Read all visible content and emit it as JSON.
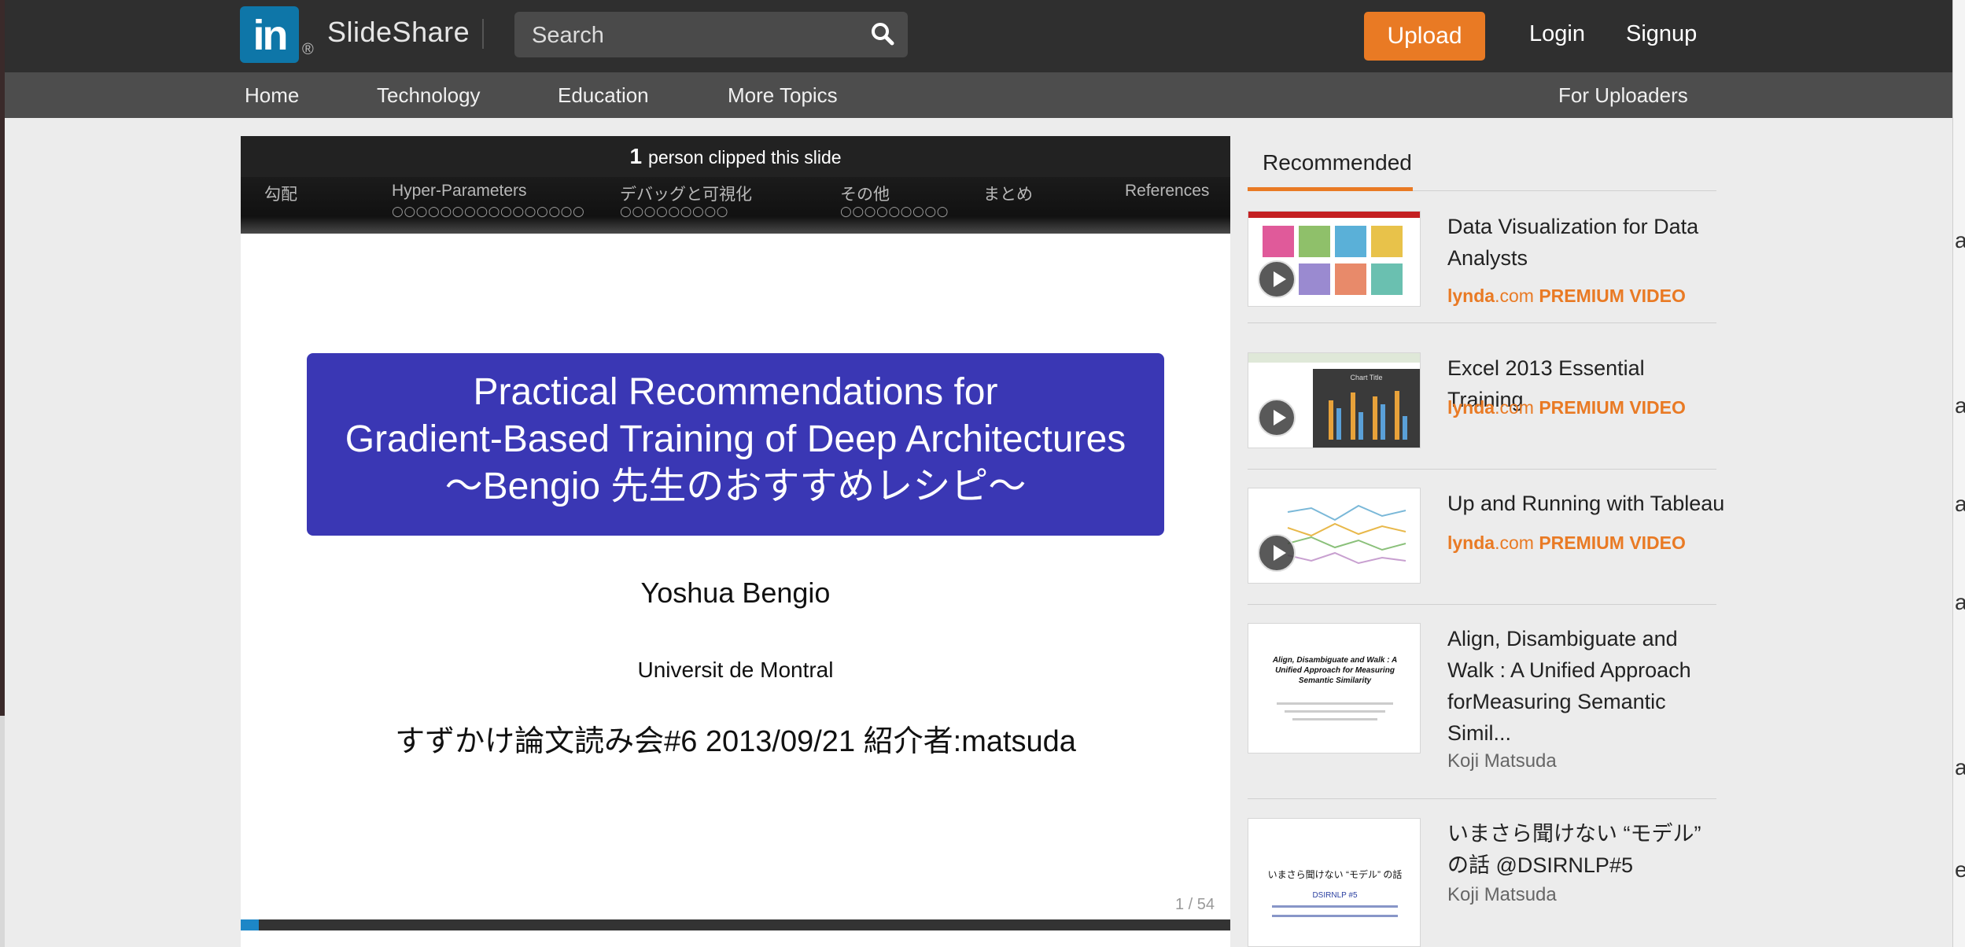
{
  "header": {
    "logo_text": "in",
    "logo_reg": "®",
    "brand": "SlideShare",
    "search_placeholder": "Search",
    "upload_label": "Upload",
    "login_label": "Login",
    "signup_label": "Signup",
    "accent": "#e97a24"
  },
  "nav": {
    "home": "Home",
    "technology": "Technology",
    "education": "Education",
    "more_topics": "More Topics",
    "for_uploaders": "For Uploaders"
  },
  "slide": {
    "clip_count": "1",
    "clip_text": "person clipped this slide",
    "beamer_nav": {
      "items": [
        "勾配",
        "Hyper-Parameters",
        "デバッグと可視化",
        "その他",
        "まとめ",
        "References"
      ],
      "dots": [
        "",
        "○○○○○○○○○○○○○○○○",
        "○○○○○○○○○",
        "○○○○○○○○○",
        "",
        ""
      ]
    },
    "title_lines": [
      "Practical Recommendations for",
      "Gradient-Based Training of Deep Architectures",
      "～Bengio 先生のおすすめレシピ～"
    ],
    "author": "Yoshua Bengio",
    "institution": "Universit de Montral",
    "event": "すずかけ論文読み会#6 2013/09/21 紹介者:matsuda",
    "page_indicator": "1 / 54",
    "progress_fraction": 0.0185,
    "title_box_color": "#3a37b4"
  },
  "recommended": {
    "tab_label": "Recommended",
    "items": [
      {
        "title": "Data Visualization for Data Analysts",
        "src_lynda": "lynda",
        "src_dotcom": ".com",
        "src_tag": "PREMIUM VIDEO"
      },
      {
        "title": "Excel 2013 Essential Training",
        "src_lynda": "lynda",
        "src_dotcom": ".com",
        "src_tag": "PREMIUM VIDEO",
        "thumb_chart_title": "Chart Title"
      },
      {
        "title": "Up and Running with Tableau",
        "src_lynda": "lynda",
        "src_dotcom": ".com",
        "src_tag": "PREMIUM VIDEO"
      },
      {
        "title": "Align, Disambiguate and Walk : A Unified Approach forMeasuring Semantic Simil...",
        "author": "Koji Matsuda",
        "thumb_title": "Align, Disambiguate and Walk : A Unified Approach for Measuring Semantic Similarity"
      },
      {
        "title": "いまさら聞けない “モデル” の話 @DSIRNLP#5",
        "author": "Koji Matsuda",
        "thumb_title": "いまさら聞けない “モデル” の話",
        "thumb_sub": "DSIRNLP #5"
      }
    ]
  },
  "right_edge_fragments": [
    "a",
    "a",
    "a",
    "a",
    "a",
    "e"
  ]
}
